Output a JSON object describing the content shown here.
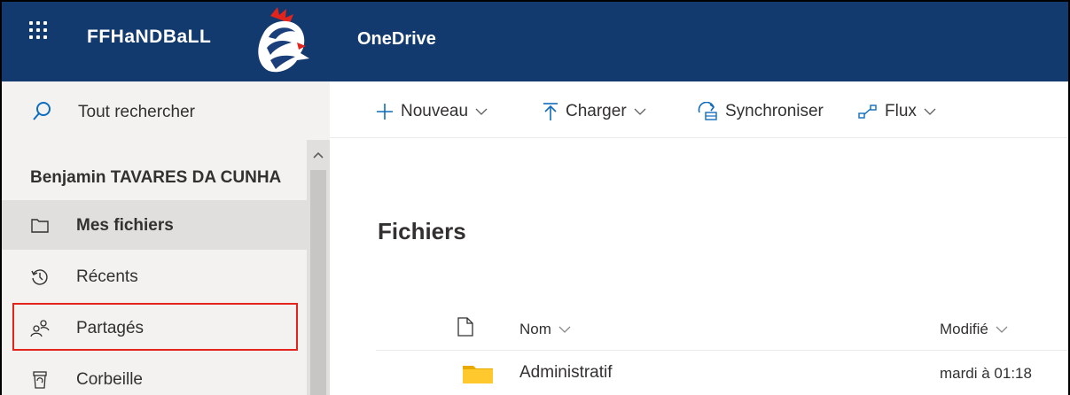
{
  "header": {
    "brand": "FFHaNDBaLL",
    "app_title": "OneDrive",
    "colors": {
      "bar": "#123a6e",
      "logo_red": "#e3241c",
      "logo_blue": "#1b3f7a"
    }
  },
  "search": {
    "label": "Tout rechercher",
    "icon": "search-icon"
  },
  "toolbar": {
    "new_label": "Nouveau",
    "upload_label": "Charger",
    "sync_label": "Synchroniser",
    "flow_label": "Flux"
  },
  "sidebar": {
    "user_name": "Benjamin TAVARES DA CUNHA",
    "items": [
      {
        "label": "Mes fichiers",
        "icon": "folder-icon",
        "active": true
      },
      {
        "label": "Récents",
        "icon": "recent-icon",
        "active": false
      },
      {
        "label": "Partagés",
        "icon": "shared-icon",
        "active": false,
        "highlighted": true
      },
      {
        "label": "Corbeille",
        "icon": "recycle-bin-icon",
        "active": false
      }
    ]
  },
  "main": {
    "title": "Fichiers",
    "columns": {
      "name": "Nom",
      "modified": "Modifié"
    },
    "rows": [
      {
        "name": "Administratif",
        "modified": "mardi à 01:18",
        "icon": "folder-icon"
      }
    ]
  }
}
